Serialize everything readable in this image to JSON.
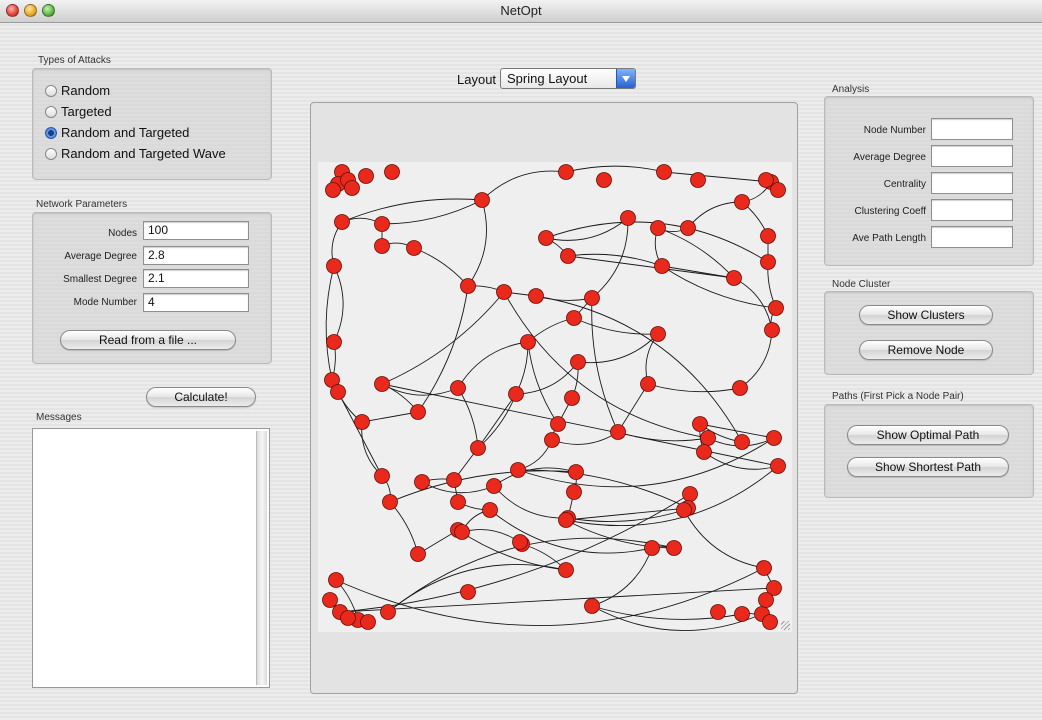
{
  "window": {
    "title": "NetOpt"
  },
  "attacks": {
    "group_label": "Types of Attacks",
    "options": [
      {
        "label": "Random",
        "selected": false
      },
      {
        "label": "Targeted",
        "selected": false
      },
      {
        "label": "Random and Targeted",
        "selected": true
      },
      {
        "label": "Random and Targeted Wave",
        "selected": false
      }
    ]
  },
  "network": {
    "group_label": "Network Parameters",
    "params": [
      {
        "label": "Nodes",
        "value": "100"
      },
      {
        "label": "Average Degree",
        "value": "2.8"
      },
      {
        "label": "Smallest Degree",
        "value": "2.1"
      },
      {
        "label": "Mode Number",
        "value": "4"
      }
    ],
    "read_button": "Read from a file ..."
  },
  "calculate_button": "Calculate!",
  "messages": {
    "label": "Messages",
    "text": ""
  },
  "layout": {
    "label": "Layout",
    "selected": "Spring Layout"
  },
  "analysis": {
    "group_label": "Analysis",
    "fields": [
      {
        "label": "Node Number",
        "value": ""
      },
      {
        "label": "Average Degree",
        "value": ""
      },
      {
        "label": "Centrality",
        "value": ""
      },
      {
        "label": "Clustering Coeff",
        "value": ""
      },
      {
        "label": "Ave Path Length",
        "value": ""
      }
    ]
  },
  "node_cluster": {
    "group_label": "Node Cluster",
    "show_clusters": "Show Clusters",
    "remove_node": "Remove Node"
  },
  "paths": {
    "group_label": "Paths (First Pick a Node Pair)",
    "optimal": "Show Optimal Path",
    "shortest": "Show Shortest Path"
  },
  "colors": {
    "node": "#e8291c",
    "node_stroke": "#6a0d08",
    "edge": "#1a1a1a",
    "accent": "#2f6fd0"
  }
}
